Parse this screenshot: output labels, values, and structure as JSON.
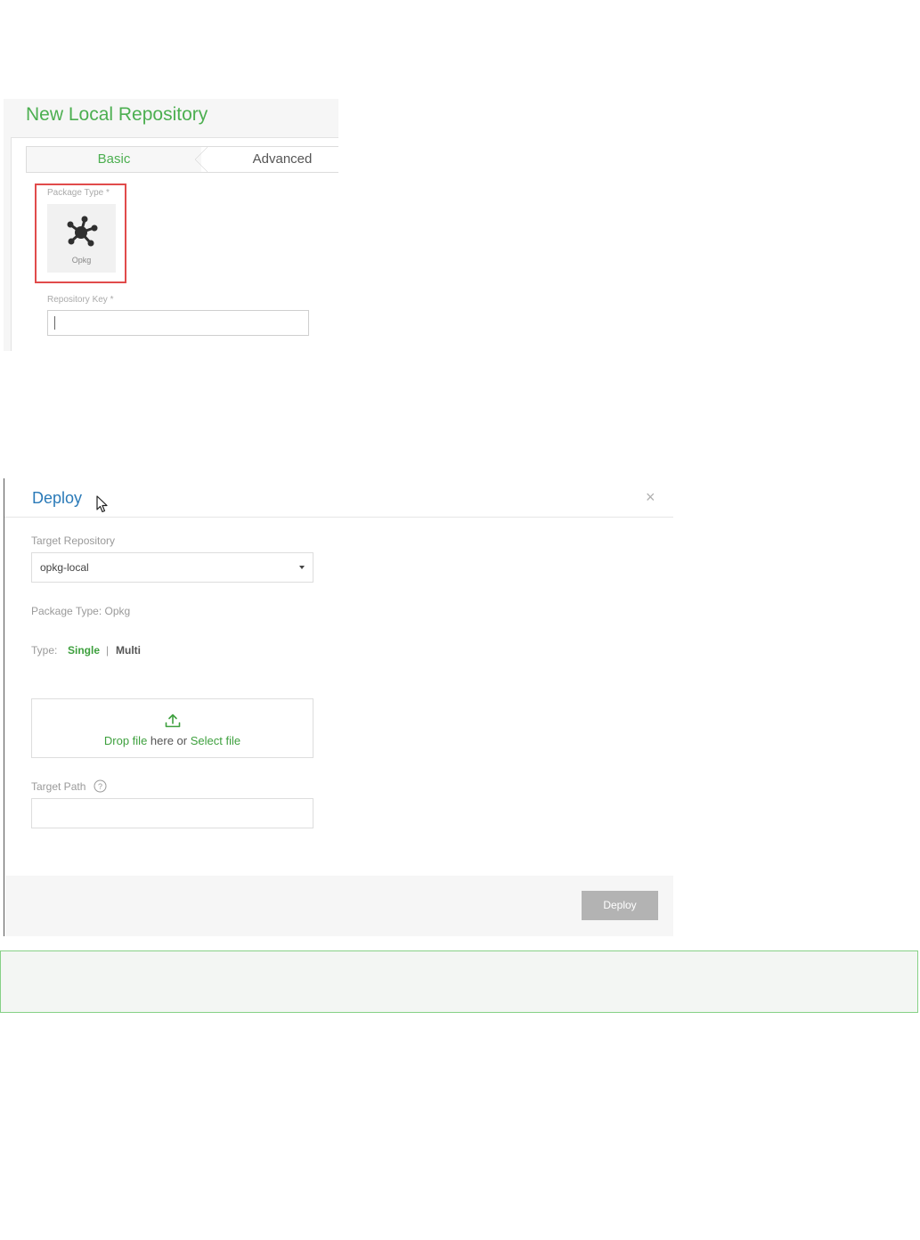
{
  "repo_panel": {
    "title": "New Local Repository",
    "tabs": [
      {
        "label": "Basic",
        "active": true
      },
      {
        "label": "Advanced",
        "active": false
      }
    ],
    "package_type_label": "Package Type *",
    "package_type_name": "Opkg",
    "repository_key_label": "Repository Key *",
    "repository_key_value": "",
    "highlight_color": "#e14b4b"
  },
  "deploy_modal": {
    "title": "Deploy",
    "close_symbol": "×",
    "target_repository_label": "Target Repository",
    "target_repository_value": "opkg-local",
    "package_type_text": "Package Type: Opkg",
    "type_label": "Type:",
    "type_options": {
      "single": "Single",
      "multi": "Multi",
      "separator": "|"
    },
    "type_selected": "Single",
    "drop_zone": {
      "drop_link": "Drop file",
      "middle_text": " here or ",
      "select_link": "Select file"
    },
    "target_path_label": "Target Path",
    "target_path_value": "",
    "deploy_button_label": "Deploy",
    "accent_color": "#3ea03e",
    "title_color": "#2a7ab8"
  },
  "callout": {
    "border_color": "#86d186"
  },
  "icons": [
    "opkg-package-icon",
    "mouse-cursor-icon",
    "close-icon",
    "select-caret-icon",
    "upload-icon",
    "help-icon"
  ]
}
